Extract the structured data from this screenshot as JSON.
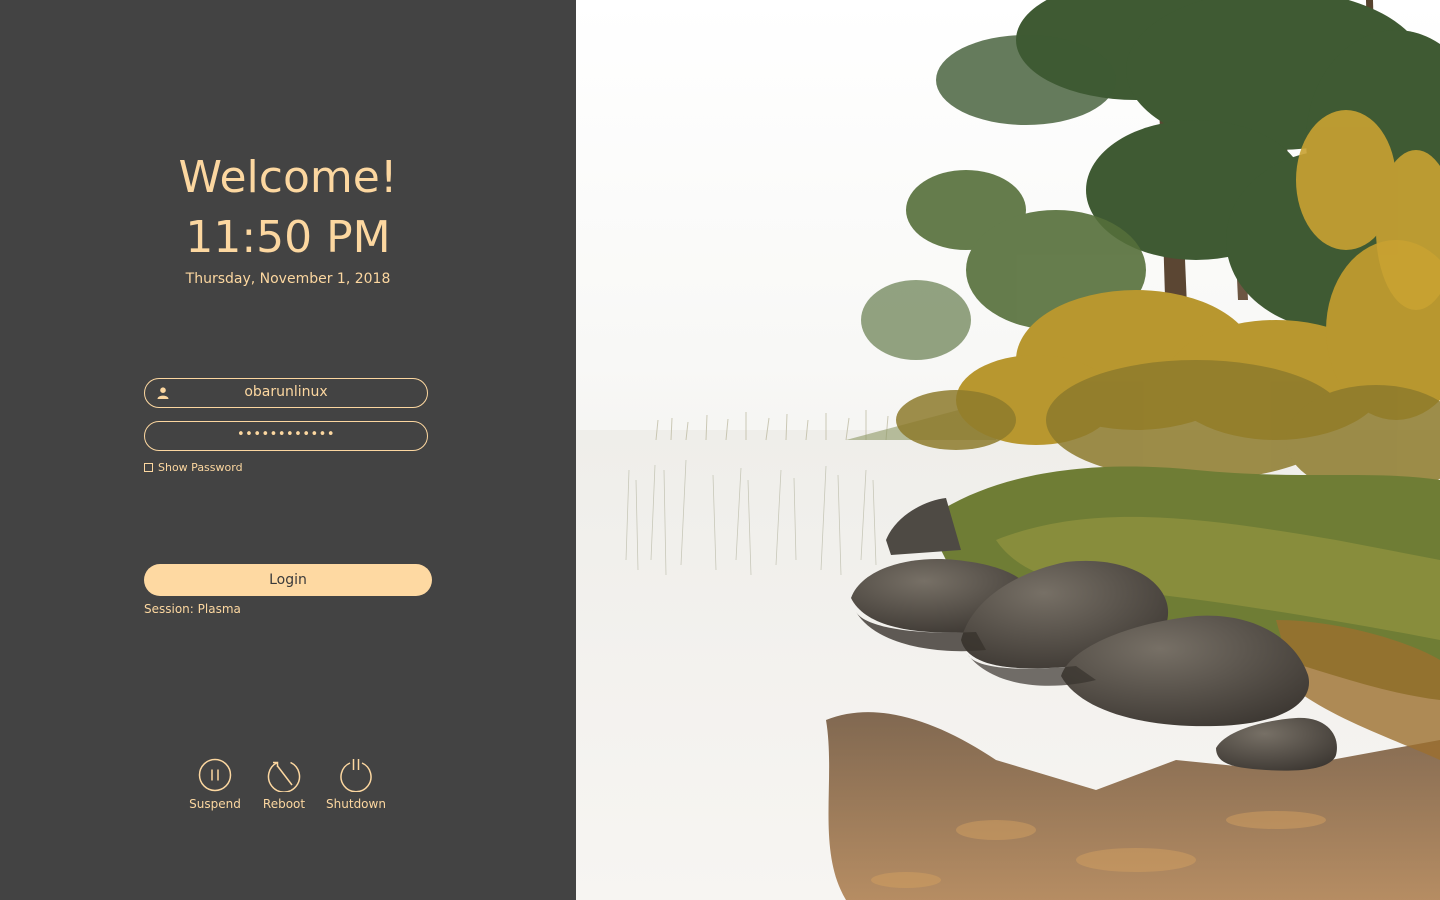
{
  "greeting": "Welcome!",
  "clock": {
    "time": "11:50 PM",
    "date": "Thursday, November 1, 2018"
  },
  "login": {
    "username": "obarunlinux",
    "password_masked": "••••••••••••",
    "show_password_label": "Show Password",
    "show_password_checked": false,
    "login_button": "Login",
    "session_label": "Session: Plasma"
  },
  "actions": [
    {
      "label": "Suspend",
      "icon": "pause-circle-icon"
    },
    {
      "label": "Reboot",
      "icon": "reboot-icon"
    },
    {
      "label": "Shutdown",
      "icon": "power-icon"
    }
  ],
  "colors": {
    "panel_bg": "#434343",
    "accent": "#fcd7a0",
    "button_bg": "#fed9a2",
    "button_text": "#3a3a3a"
  },
  "wallpaper": {
    "description_icon": "lake-forest-wallpaper"
  }
}
